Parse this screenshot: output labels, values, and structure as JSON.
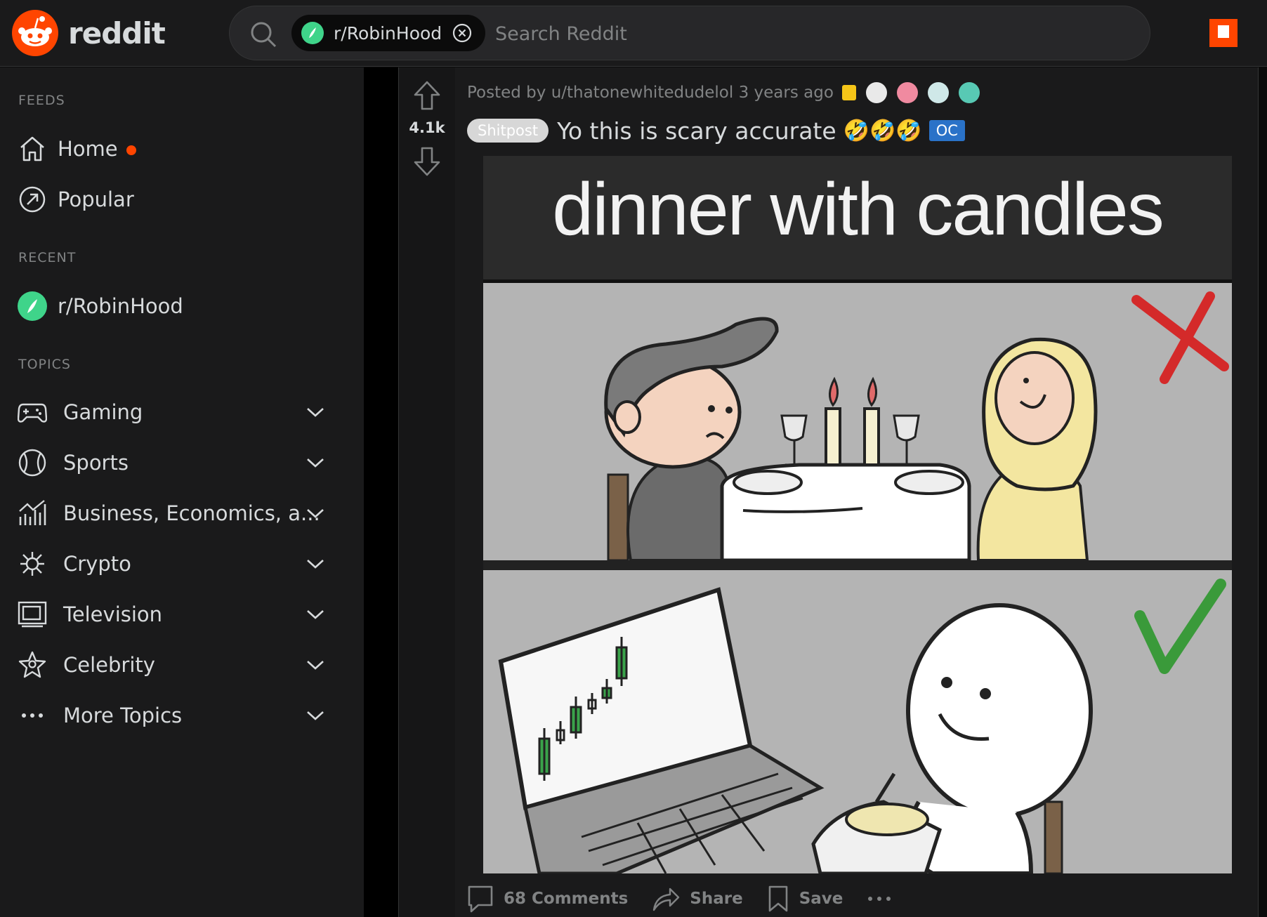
{
  "header": {
    "wordmark": "reddit",
    "search": {
      "community_chip": "r/RobinHood",
      "placeholder": "Search Reddit"
    }
  },
  "sidebar": {
    "feeds_label": "FEEDS",
    "feeds": [
      {
        "label": "Home",
        "icon": "home-icon",
        "has_dot": true
      },
      {
        "label": "Popular",
        "icon": "popular-icon"
      }
    ],
    "recent_label": "RECENT",
    "recent": [
      {
        "label": "r/RobinHood",
        "icon": "robinhood-community-icon"
      }
    ],
    "topics_label": "TOPICS",
    "topics": [
      {
        "label": "Gaming",
        "icon": "gamepad-icon"
      },
      {
        "label": "Sports",
        "icon": "sports-ball-icon"
      },
      {
        "label": "Business, Economics, a...",
        "icon": "business-chart-icon"
      },
      {
        "label": "Crypto",
        "icon": "crypto-icon"
      },
      {
        "label": "Television",
        "icon": "television-icon"
      },
      {
        "label": "Celebrity",
        "icon": "celebrity-star-icon"
      },
      {
        "label": "More Topics",
        "icon": "more-dots-icon"
      }
    ]
  },
  "post": {
    "score": "4.1k",
    "meta": "Posted by u/thatonewhitedudelol 3 years ago",
    "flair": "Shitpost",
    "title": "Yo this is scary accurate",
    "emoji": "🤣🤣🤣",
    "oc_badge": "OC",
    "meme": {
      "caption": "dinner with candles"
    },
    "actions": {
      "comments": "68 Comments",
      "share": "Share",
      "save": "Save"
    }
  },
  "colors": {
    "brand": "#ff4500",
    "robinhood_green": "#3fd48a",
    "bg": "#1a1a1b",
    "text": "#d7dadc",
    "muted": "#818384",
    "oc_blue": "#2a72c8"
  }
}
